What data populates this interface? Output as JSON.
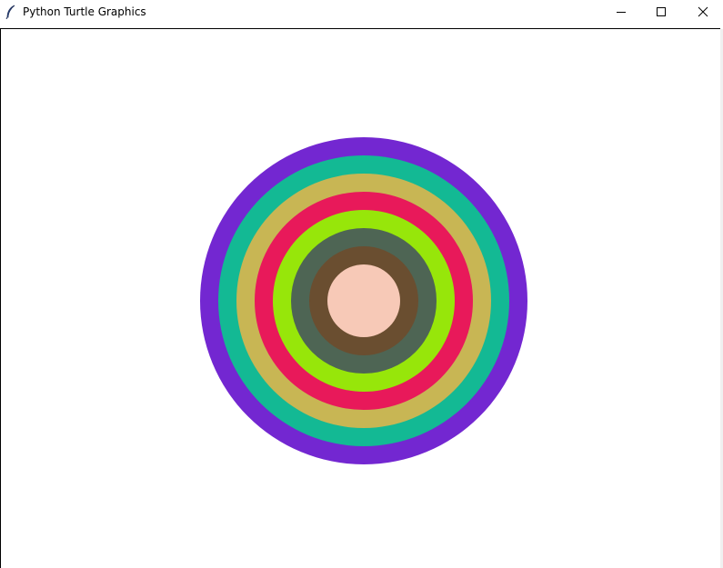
{
  "window": {
    "title": "Python Turtle Graphics",
    "icon": "feather-icon",
    "controls": {
      "minimize": "minimize-icon",
      "maximize": "maximize-icon",
      "close": "close-icon"
    }
  },
  "canvas": {
    "background": "#ffffff",
    "rings": [
      {
        "color": "#7327d1"
      },
      {
        "color": "#13b994"
      },
      {
        "color": "#c8b654"
      },
      {
        "color": "#e8195a"
      },
      {
        "color": "#97e60a"
      },
      {
        "color": "#4e6554"
      },
      {
        "color": "#6a4e30"
      },
      {
        "color": "#f7c9b7"
      }
    ]
  }
}
